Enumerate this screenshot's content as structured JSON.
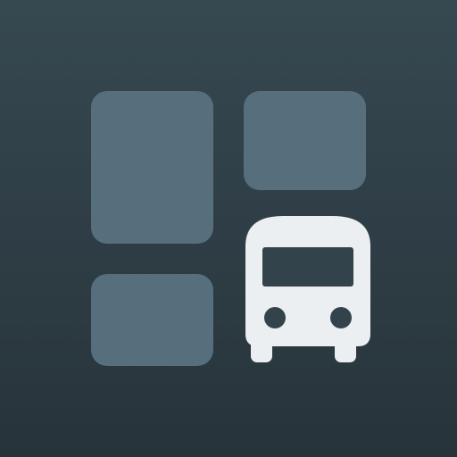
{
  "icon": {
    "background_color": "#2f3e46",
    "tile_color": "#576f7d",
    "bus_color": "#eceff1",
    "bus_window_color": "#33434b",
    "glyphs": [
      "tile-tall",
      "tile-top-right",
      "tile-bottom-left",
      "bus-icon"
    ]
  }
}
